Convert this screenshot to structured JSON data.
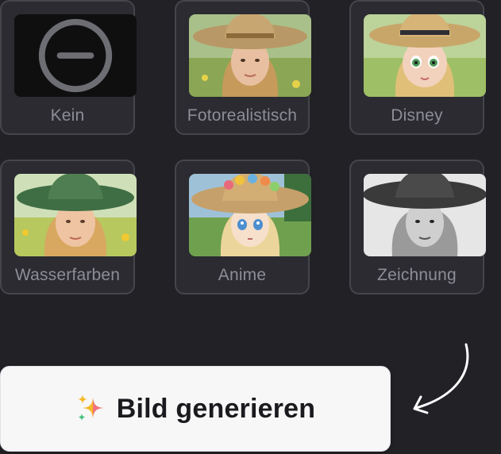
{
  "styles": [
    {
      "label": "Kein",
      "icon": "no-style-icon"
    },
    {
      "label": "Fotorealistisch",
      "icon": "portrait-photo"
    },
    {
      "label": "Disney",
      "icon": "portrait-cartoon"
    },
    {
      "label": "Wasserfarben",
      "icon": "portrait-watercolor"
    },
    {
      "label": "Anime",
      "icon": "portrait-anime"
    },
    {
      "label": "Zeichnung",
      "icon": "portrait-sketch"
    }
  ],
  "generate": {
    "label": "Bild generieren",
    "icon": "sparkles-icon"
  },
  "colors": {
    "background": "#212126",
    "card_border": "#45454c",
    "label": "#8d8d95",
    "button_bg": "#f7f7f8",
    "sparkle_gold": "#f5b928",
    "sparkle_pink": "#ef5b9c",
    "sparkle_green": "#3cbf7a"
  }
}
